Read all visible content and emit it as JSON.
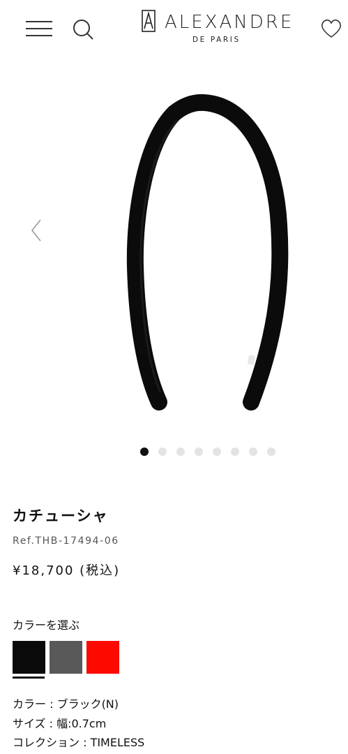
{
  "brand": {
    "name": "ALEXANDRE",
    "sub": "DE PARIS"
  },
  "gallery": {
    "dots_total": 8,
    "dots_active_index": 0
  },
  "product": {
    "title": "カチューシャ",
    "ref": "Ref.THB-17494-06",
    "price": "¥18,700 (税込)"
  },
  "colors": {
    "heading": "カラーを選ぶ",
    "swatches": [
      {
        "name": "black",
        "hex": "#0a0a0a",
        "selected": true
      },
      {
        "name": "gray",
        "hex": "#595959",
        "selected": false
      },
      {
        "name": "red",
        "hex": "#fc0a00",
        "selected": false
      }
    ]
  },
  "specs": [
    "カラー : ブラック(N)",
    "サイズ : 幅:0.7cm",
    "コレクション : TIMELESS"
  ],
  "icons": [
    "menu-icon",
    "search-icon",
    "heart-icon",
    "chevron-left-icon"
  ]
}
